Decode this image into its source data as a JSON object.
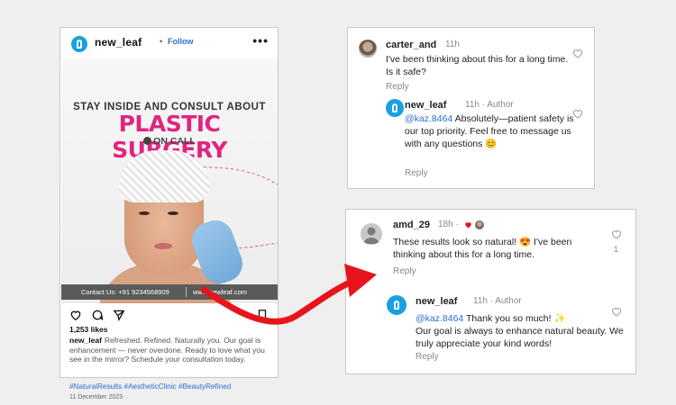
{
  "post": {
    "username": "new_leaf",
    "dot": "•",
    "follow_label": "Follow",
    "more_label": "•••",
    "image": {
      "headline": "STAY INSIDE AND CONSULT ABOUT",
      "title": "PLASTIC SURGERY",
      "subtitle": "ON CALL",
      "contact": "Contact Us: +91 9234568909",
      "website": "www.newleaf.com"
    },
    "likes": "1,253 likes",
    "caption_user": "new_leaf",
    "caption_text": "Refreshed. Refined. Naturally you. Our goal is enhancement — never overdone. Ready to love what you see in the mirror? Schedule your consultation today.",
    "hashtags": "#NaturalResults #AestheticClinic #BeautyRefined",
    "date": "11 December 2023"
  },
  "comment_card_1": {
    "comment": {
      "username": "carter_and",
      "time": "11h",
      "text": "I've been thinking about this for a long time. Is it safe?",
      "reply_label": "Reply"
    },
    "reply": {
      "username": "new_leaf",
      "meta": "11h · Author",
      "mention": "@kaz.8464",
      "text": " Absolutely—patient safety is our top priority. Feel free to message us with any questions 😊",
      "reply_label": "Reply"
    }
  },
  "comment_card_2": {
    "comment": {
      "username": "amd_29",
      "time": "18h ·",
      "text": "These results look so natural! 😍 I've been thinking about this for a long time.",
      "reply_label": "Reply",
      "like_count": "1"
    },
    "reply": {
      "username": "new_leaf",
      "meta": "11h · Author",
      "mention": "@kaz.8464",
      "text_line1": " Thank you so much! ✨",
      "text_line2": "Our goal is always to enhance natural beauty. We truly appreciate your kind words!",
      "reply_label": "Reply"
    }
  },
  "colors": {
    "brand_blue": "#1aa0e0",
    "link_blue": "#2a6fd6",
    "headline_pink": "#e0257f",
    "arrow_red": "#e8141b"
  }
}
